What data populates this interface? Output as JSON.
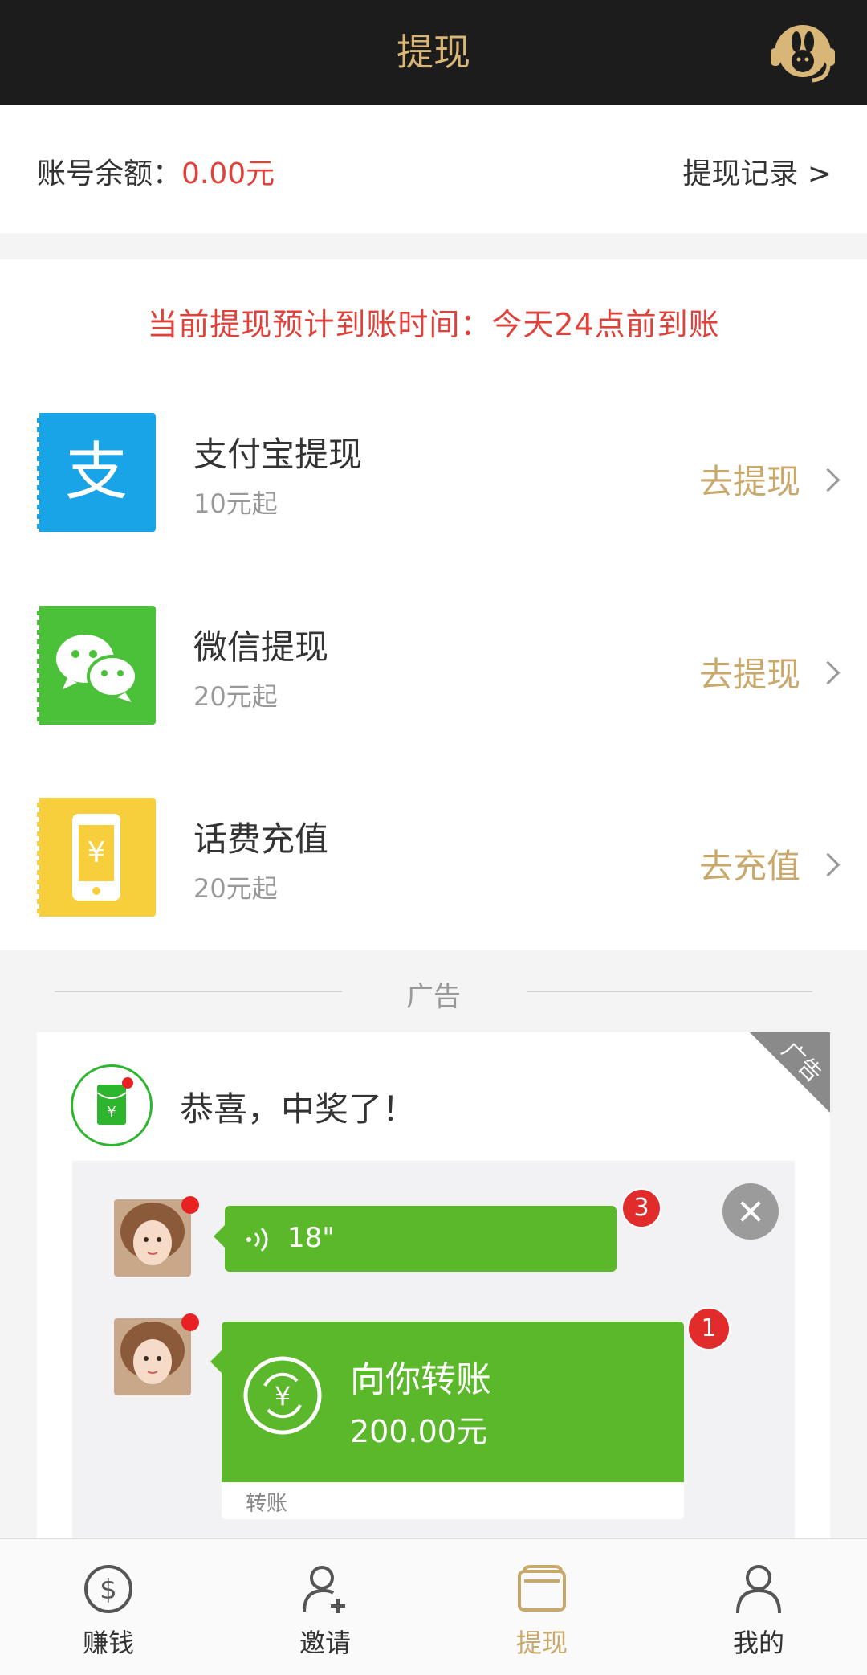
{
  "header": {
    "title": "提现",
    "service_icon": "customer-service-rabbit-icon"
  },
  "balance": {
    "label": "账号余额：",
    "amount": "0.00元",
    "record_link": "提现记录 >"
  },
  "notice": "当前提现预计到账时间：今天24点前到账",
  "methods": [
    {
      "title": "支付宝提现",
      "subtitle": "10元起",
      "action": "去提现",
      "icon": "alipay-icon",
      "color": "#1aa4e8"
    },
    {
      "title": "微信提现",
      "subtitle": "20元起",
      "action": "去提现",
      "icon": "wechat-icon",
      "color": "#4bc13a"
    },
    {
      "title": "话费充值",
      "subtitle": "20元起",
      "action": "去充值",
      "icon": "phone-recharge-icon",
      "color": "#f7cf3c"
    }
  ],
  "ad": {
    "section_label": "广告",
    "corner_label": "广告",
    "headline": "恭喜，中奖了！",
    "voice_duration": "18\"",
    "voice_badge": "3",
    "transfer_title": "向你转账",
    "transfer_amount": "200.00元",
    "transfer_badge": "1",
    "transfer_footer": "转账"
  },
  "nav": {
    "items": [
      {
        "label": "赚钱",
        "icon": "dollar-coin-icon",
        "active": false
      },
      {
        "label": "邀请",
        "icon": "add-user-icon",
        "active": false
      },
      {
        "label": "提现",
        "icon": "wallet-icon",
        "active": true
      },
      {
        "label": "我的",
        "icon": "user-icon",
        "active": false
      }
    ]
  },
  "colors": {
    "accent_gold": "#c9a96b",
    "alert_red": "#e0413a",
    "wechat_green": "#5bb82b"
  }
}
